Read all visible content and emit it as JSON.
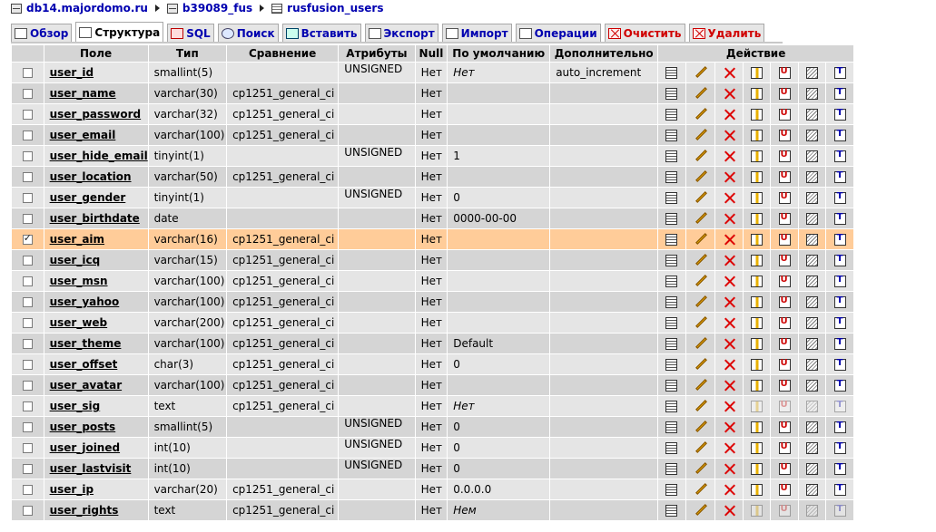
{
  "breadcrumb": {
    "server": "db14.majordomo.ru",
    "database": "b39089_fus",
    "table": "rusfusion_users"
  },
  "tabs": [
    {
      "label": "Обзор",
      "icon": "browse-icon"
    },
    {
      "label": "Структура",
      "icon": "structure-icon",
      "active": true
    },
    {
      "label": "SQL",
      "icon": "sql-icon"
    },
    {
      "label": "Поиск",
      "icon": "search-icon"
    },
    {
      "label": "Вставить",
      "icon": "insert-icon"
    },
    {
      "label": "Экспорт",
      "icon": "export-icon"
    },
    {
      "label": "Импорт",
      "icon": "import-icon"
    },
    {
      "label": "Операции",
      "icon": "operations-icon"
    },
    {
      "label": "Очистить",
      "icon": "empty-icon",
      "danger": true
    },
    {
      "label": "Удалить",
      "icon": "drop-icon",
      "danger": true
    }
  ],
  "columns": {
    "field": "Поле",
    "type": "Тип",
    "collation": "Сравнение",
    "attributes": "Атрибуты",
    "null": "Null",
    "default": "По умолчанию",
    "extra": "Дополнительно",
    "action": "Действие"
  },
  "rows": [
    {
      "field": "user_id",
      "type": "smallint(5)",
      "collation": "",
      "attributes": "UNSIGNED",
      "null": "Нет",
      "default": "Нет",
      "default_italic": true,
      "extra": "auto_increment",
      "checked": false,
      "partial_icons": false
    },
    {
      "field": "user_name",
      "type": "varchar(30)",
      "collation": "cp1251_general_ci",
      "attributes": "",
      "null": "Нет",
      "default": "",
      "extra": "",
      "checked": false,
      "partial_icons": false
    },
    {
      "field": "user_password",
      "type": "varchar(32)",
      "collation": "cp1251_general_ci",
      "attributes": "",
      "null": "Нет",
      "default": "",
      "extra": "",
      "checked": false,
      "partial_icons": false
    },
    {
      "field": "user_email",
      "type": "varchar(100)",
      "collation": "cp1251_general_ci",
      "attributes": "",
      "null": "Нет",
      "default": "",
      "extra": "",
      "checked": false,
      "partial_icons": false
    },
    {
      "field": "user_hide_email",
      "type": "tinyint(1)",
      "collation": "",
      "attributes": "UNSIGNED",
      "null": "Нет",
      "default": "1",
      "extra": "",
      "checked": false,
      "partial_icons": false
    },
    {
      "field": "user_location",
      "type": "varchar(50)",
      "collation": "cp1251_general_ci",
      "attributes": "",
      "null": "Нет",
      "default": "",
      "extra": "",
      "checked": false,
      "partial_icons": false
    },
    {
      "field": "user_gender",
      "type": "tinyint(1)",
      "collation": "",
      "attributes": "UNSIGNED",
      "null": "Нет",
      "default": "0",
      "extra": "",
      "checked": false,
      "partial_icons": false
    },
    {
      "field": "user_birthdate",
      "type": "date",
      "collation": "",
      "attributes": "",
      "null": "Нет",
      "default": "0000-00-00",
      "extra": "",
      "checked": false,
      "partial_icons": false
    },
    {
      "field": "user_aim",
      "type": "varchar(16)",
      "collation": "cp1251_general_ci",
      "attributes": "",
      "null": "Нет",
      "default": "",
      "extra": "",
      "checked": true,
      "partial_icons": false
    },
    {
      "field": "user_icq",
      "type": "varchar(15)",
      "collation": "cp1251_general_ci",
      "attributes": "",
      "null": "Нет",
      "default": "",
      "extra": "",
      "checked": false,
      "partial_icons": false
    },
    {
      "field": "user_msn",
      "type": "varchar(100)",
      "collation": "cp1251_general_ci",
      "attributes": "",
      "null": "Нет",
      "default": "",
      "extra": "",
      "checked": false,
      "partial_icons": false
    },
    {
      "field": "user_yahoo",
      "type": "varchar(100)",
      "collation": "cp1251_general_ci",
      "attributes": "",
      "null": "Нет",
      "default": "",
      "extra": "",
      "checked": false,
      "partial_icons": false
    },
    {
      "field": "user_web",
      "type": "varchar(200)",
      "collation": "cp1251_general_ci",
      "attributes": "",
      "null": "Нет",
      "default": "",
      "extra": "",
      "checked": false,
      "partial_icons": false
    },
    {
      "field": "user_theme",
      "type": "varchar(100)",
      "collation": "cp1251_general_ci",
      "attributes": "",
      "null": "Нет",
      "default": "Default",
      "extra": "",
      "checked": false,
      "partial_icons": false
    },
    {
      "field": "user_offset",
      "type": "char(3)",
      "collation": "cp1251_general_ci",
      "attributes": "",
      "null": "Нет",
      "default": "0",
      "extra": "",
      "checked": false,
      "partial_icons": false
    },
    {
      "field": "user_avatar",
      "type": "varchar(100)",
      "collation": "cp1251_general_ci",
      "attributes": "",
      "null": "Нет",
      "default": "",
      "extra": "",
      "checked": false,
      "partial_icons": false
    },
    {
      "field": "user_sig",
      "type": "text",
      "collation": "cp1251_general_ci",
      "attributes": "",
      "null": "Нет",
      "default": "Нет",
      "default_italic": true,
      "extra": "",
      "checked": false,
      "partial_icons": true
    },
    {
      "field": "user_posts",
      "type": "smallint(5)",
      "collation": "",
      "attributes": "UNSIGNED",
      "null": "Нет",
      "default": "0",
      "extra": "",
      "checked": false,
      "partial_icons": false
    },
    {
      "field": "user_joined",
      "type": "int(10)",
      "collation": "",
      "attributes": "UNSIGNED",
      "null": "Нет",
      "default": "0",
      "extra": "",
      "checked": false,
      "partial_icons": false
    },
    {
      "field": "user_lastvisit",
      "type": "int(10)",
      "collation": "",
      "attributes": "UNSIGNED",
      "null": "Нет",
      "default": "0",
      "extra": "",
      "checked": false,
      "partial_icons": false
    },
    {
      "field": "user_ip",
      "type": "varchar(20)",
      "collation": "cp1251_general_ci",
      "attributes": "",
      "null": "Нет",
      "default": "0.0.0.0",
      "extra": "",
      "checked": false,
      "partial_icons": false
    },
    {
      "field": "user_rights",
      "type": "text",
      "collation": "cp1251_general_ci",
      "attributes": "",
      "null": "Нет",
      "default": "Нем",
      "default_italic": true,
      "extra": "",
      "checked": false,
      "partial_icons": true
    }
  ],
  "action_icons": [
    "browse-icon",
    "edit-icon",
    "drop-icon",
    "primary-key-icon",
    "unique-icon",
    "index-icon",
    "fulltext-icon"
  ],
  "colors": {
    "header_bg": "#d5d5d5",
    "row_odd": "#e5e5e5",
    "row_even": "#d5d5d5",
    "row_marked": "#ffcc99",
    "link": "#0000b0",
    "danger": "#d00000"
  }
}
